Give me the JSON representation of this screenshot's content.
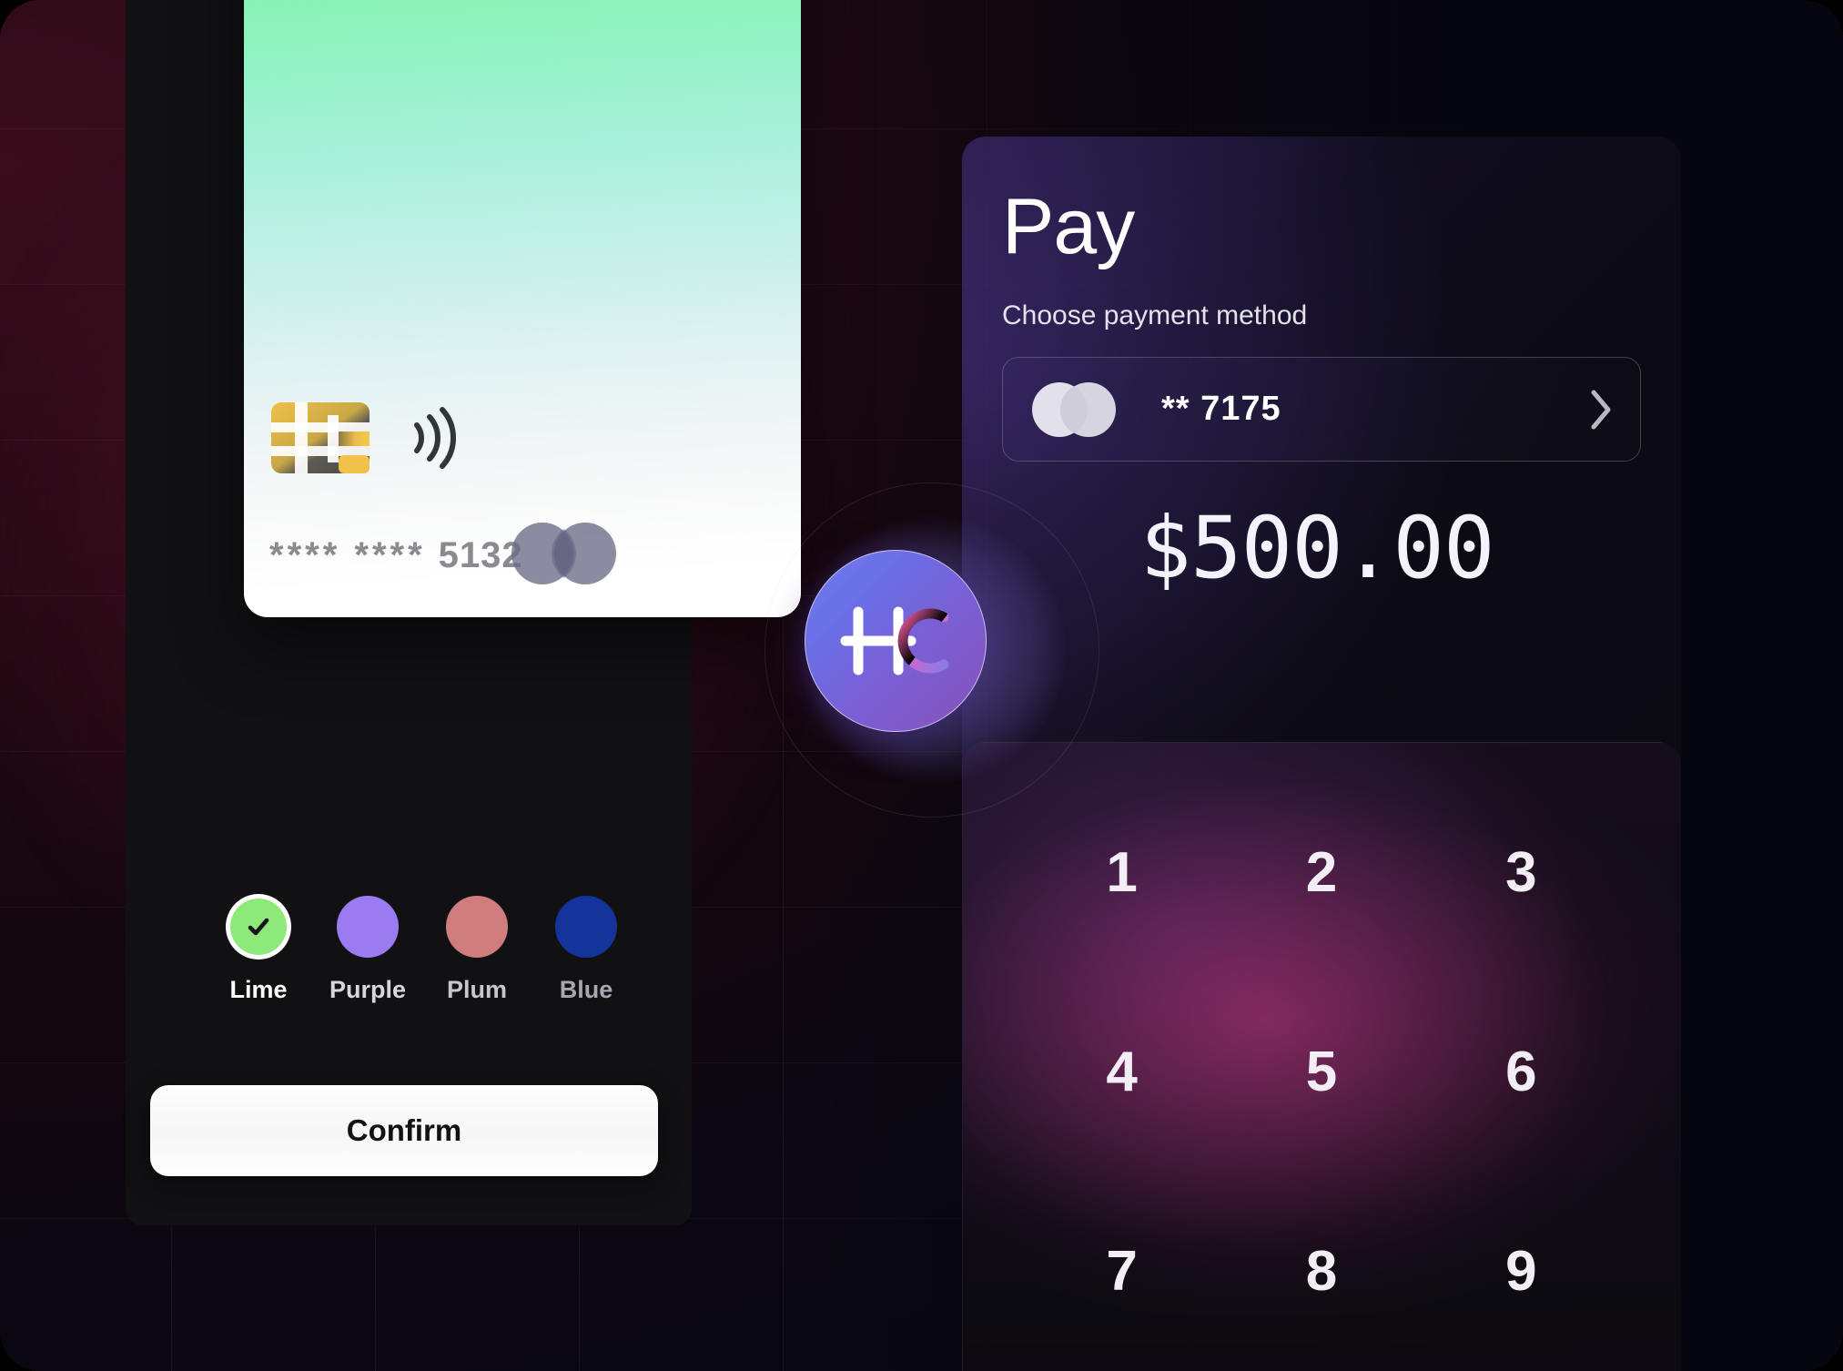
{
  "card_panel": {
    "card": {
      "chip_icon": "emv-chip-icon",
      "contactless_icon": "contactless-icon",
      "masked_digits": "**** ****",
      "last4": "5132",
      "network_logo": "mastercard-logo"
    },
    "swatches": [
      {
        "label": "Lime",
        "color": "#8ee97b",
        "selected": true,
        "check_icon": "check-icon"
      },
      {
        "label": "Purple",
        "color": "#9c7bf0",
        "selected": false
      },
      {
        "label": "Plum",
        "color": "#d07d7d",
        "selected": false
      },
      {
        "label": "Blue",
        "color": "#14349b",
        "selected": false
      }
    ],
    "confirm_label": "Confirm"
  },
  "pay_panel": {
    "title": "Pay",
    "subtitle": "Choose payment method",
    "method": {
      "logo_icon": "mastercard-logo",
      "label": "** 7175",
      "chevron_icon": "chevron-right-icon"
    },
    "amount": "$500.00"
  },
  "keypad": {
    "keys": [
      "1",
      "2",
      "3",
      "4",
      "5",
      "6",
      "7",
      "8",
      "9"
    ]
  },
  "brand_badge": {
    "logo_icon": "hc-monogram-icon",
    "letter_h": "H",
    "letter_c": "C"
  },
  "colors": {
    "accent_green": "#8ee97b",
    "accent_purple": "#9c7bf0",
    "accent_plum": "#d07d7d",
    "accent_blue": "#14349b",
    "badge_pink": "#ef5fa8",
    "panel_dark": "#111114"
  }
}
